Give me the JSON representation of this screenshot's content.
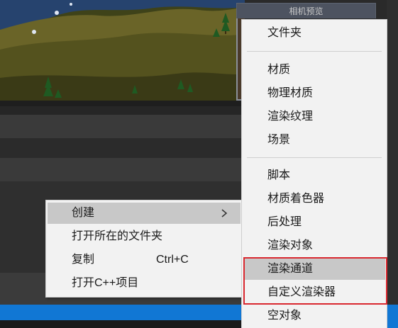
{
  "preview": {
    "title": "相机预览"
  },
  "context_menu": {
    "items": [
      {
        "label": "创建",
        "shortcut": "",
        "submenu": true,
        "highlighted": true
      },
      {
        "label": "打开所在的文件夹",
        "shortcut": ""
      },
      {
        "label": "复制",
        "shortcut": "Ctrl+C"
      },
      {
        "label": "打开C++项目",
        "shortcut": ""
      }
    ],
    "submenu_arrow": "›"
  },
  "create_submenu": {
    "items": [
      {
        "label": "文件夹"
      },
      {
        "label": "材质"
      },
      {
        "label": "物理材质"
      },
      {
        "label": "渲染纹理"
      },
      {
        "label": "场景"
      },
      {
        "label": "脚本"
      },
      {
        "label": "材质着色器"
      },
      {
        "label": "后处理"
      },
      {
        "label": "渲染对象"
      },
      {
        "label": "渲染通道",
        "highlighted": true
      },
      {
        "label": "自定义渲染器"
      },
      {
        "label": "空对象"
      }
    ],
    "annotation_color": "#d9282f"
  }
}
